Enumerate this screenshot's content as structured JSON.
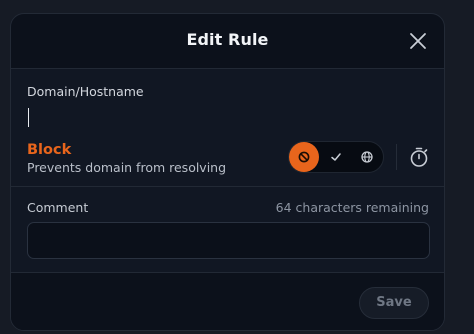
{
  "dialog": {
    "title": "Edit Rule",
    "close_icon": "close-icon"
  },
  "domain": {
    "label": "Domain/Hostname",
    "value": "",
    "placeholder": ""
  },
  "action": {
    "title": "Block",
    "description": "Prevents domain from resolving",
    "modes": [
      {
        "name": "block",
        "icon": "block-icon",
        "active": true
      },
      {
        "name": "allow",
        "icon": "check-icon",
        "active": false
      },
      {
        "name": "redirect",
        "icon": "globe-icon",
        "active": false
      }
    ],
    "timer_icon": "stopwatch-icon"
  },
  "comment": {
    "label": "Comment",
    "remaining": "64 characters remaining",
    "value": ""
  },
  "footer": {
    "save_label": "Save"
  },
  "colors": {
    "accent": "#e8651c",
    "background": "#0c111b",
    "text": "#f2f4f7"
  }
}
